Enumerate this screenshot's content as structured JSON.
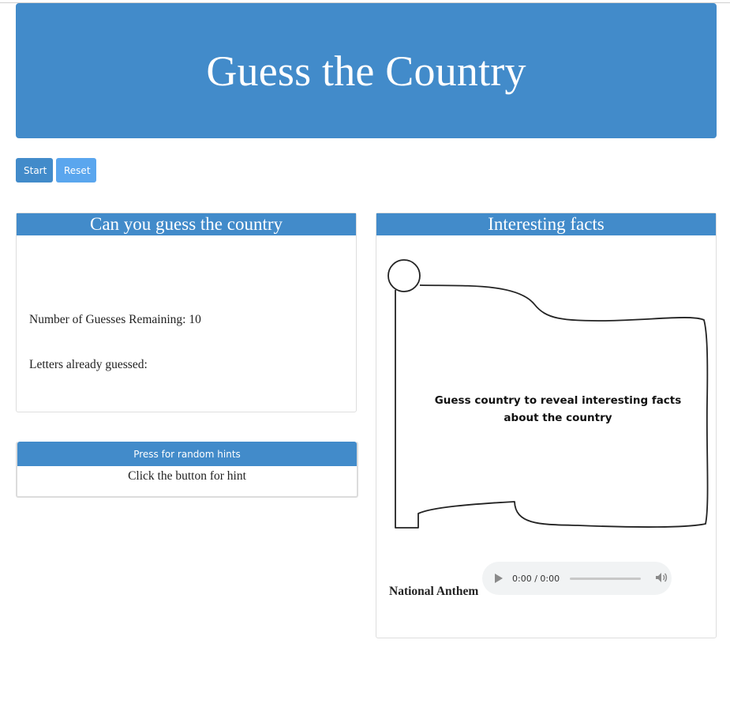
{
  "header": {
    "title": "Guess the Country"
  },
  "controls": {
    "start_label": "Start",
    "reset_label": "Reset"
  },
  "guess_panel": {
    "title": "Can you guess the country",
    "guesses_remaining_label": "Number of Guesses Remaining: 10",
    "letters_guessed_label": "Letters already guessed:"
  },
  "hint_panel": {
    "button_label": "Press for random hints",
    "hint_text": "Click the button for hint"
  },
  "facts_panel": {
    "title": "Interesting facts",
    "flag_message_line1": "Guess country to reveal interesting facts",
    "flag_message_line2": "about the country",
    "anthem_label": "National Anthem",
    "audio_time": "0:00 / 0:00"
  },
  "colors": {
    "primary": "#428bca",
    "secondary": "#5aa6ee"
  }
}
